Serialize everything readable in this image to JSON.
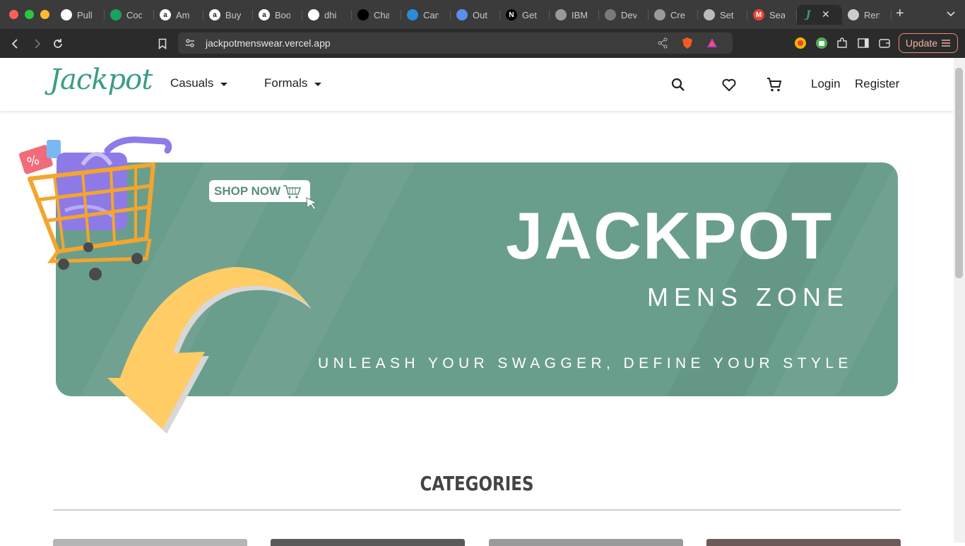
{
  "browser": {
    "tabs": [
      {
        "title": "Pull",
        "icon": "github-icon",
        "color": "#ffffff",
        "glyph": ""
      },
      {
        "title": "Coo",
        "icon": "sheets-icon",
        "color": "#1aa260",
        "glyph": ""
      },
      {
        "title": "Am",
        "icon": "amazon-icon",
        "color": "#ffffff",
        "glyph": "a"
      },
      {
        "title": "Buy",
        "icon": "amazon-icon",
        "color": "#ffffff",
        "glyph": "a"
      },
      {
        "title": "Boo",
        "icon": "amazon-icon",
        "color": "#ffffff",
        "glyph": "a"
      },
      {
        "title": "dhi",
        "icon": "github-icon",
        "color": "#ffffff",
        "glyph": ""
      },
      {
        "title": "Cha",
        "icon": "chatgpt-icon",
        "color": "#000000",
        "glyph": ""
      },
      {
        "title": "Can",
        "icon": "canva-icon",
        "color": "#2a8bd8",
        "glyph": ""
      },
      {
        "title": "Out",
        "icon": "outlook-icon",
        "color": "#5b8def",
        "glyph": ""
      },
      {
        "title": "Get",
        "icon": "nextjs-icon",
        "color": "#000000",
        "glyph": "N"
      },
      {
        "title": "IBM",
        "icon": "globe-icon",
        "color": "#9a9a9a",
        "glyph": ""
      },
      {
        "title": "Dev",
        "icon": "devfolio-icon",
        "color": "#7a7a7a",
        "glyph": ""
      },
      {
        "title": "Cre",
        "icon": "globe-icon",
        "color": "#9a9a9a",
        "glyph": ""
      },
      {
        "title": "Set",
        "icon": "gear-icon",
        "color": "#bbbbbb",
        "glyph": ""
      },
      {
        "title": "Sea",
        "icon": "gmail-icon",
        "color": "#ea4335",
        "glyph": "M"
      },
      {
        "title": "",
        "icon": "jackpot-favicon",
        "color": "#3a9d86",
        "glyph": "J",
        "active": true
      },
      {
        "title": "Ren",
        "icon": "render-icon",
        "color": "#cccccc",
        "glyph": ""
      }
    ],
    "url": "jackpotmenswear.vercel.app",
    "update_label": "Update"
  },
  "site": {
    "logo": "Jackpot",
    "brand_color": "#3a9d86",
    "nav": [
      {
        "label": "Casuals"
      },
      {
        "label": "Formals"
      }
    ],
    "login": "Login",
    "register": "Register"
  },
  "hero": {
    "shop_now": "SHOP NOW",
    "title": "JACKPOT",
    "subtitle": "MENS ZONE",
    "tagline": "UNLEASH YOUR SWAGGER, DEFINE YOUR STYLE",
    "banner_color": "#6a9e8c"
  },
  "categories": {
    "title": "CATEGORIES"
  }
}
